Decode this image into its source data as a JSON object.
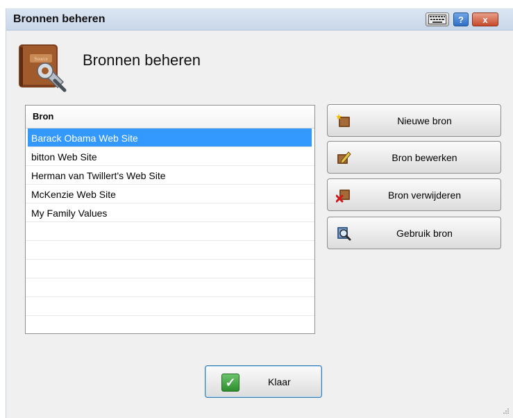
{
  "window": {
    "title": "Bronnen beheren",
    "controls": {
      "keyboard_icon": "keyboard-icon",
      "help_label": "?",
      "close_label": "x"
    }
  },
  "header": {
    "title": "Bronnen beheren",
    "icon": "book-wrench-icon",
    "icon_caption": "Source"
  },
  "list": {
    "column_header": "Bron",
    "rows": [
      "Barack Obama Web Site",
      "bitton Web Site",
      "Herman van Twillert's Web Site",
      "McKenzie Web Site",
      "My Family Values"
    ],
    "selected_index": 0
  },
  "actions": {
    "new_label": "Nieuwe bron",
    "edit_label": "Bron bewerken",
    "delete_label": "Bron verwijderen",
    "use_label": "Gebruik bron"
  },
  "footer": {
    "done_label": "Klaar"
  },
  "colors": {
    "selection": "#3399ff",
    "titlebar": "#dce6f2",
    "close": "#c74a2c",
    "help": "#2f6fc4",
    "check": "#2d8d2d"
  }
}
